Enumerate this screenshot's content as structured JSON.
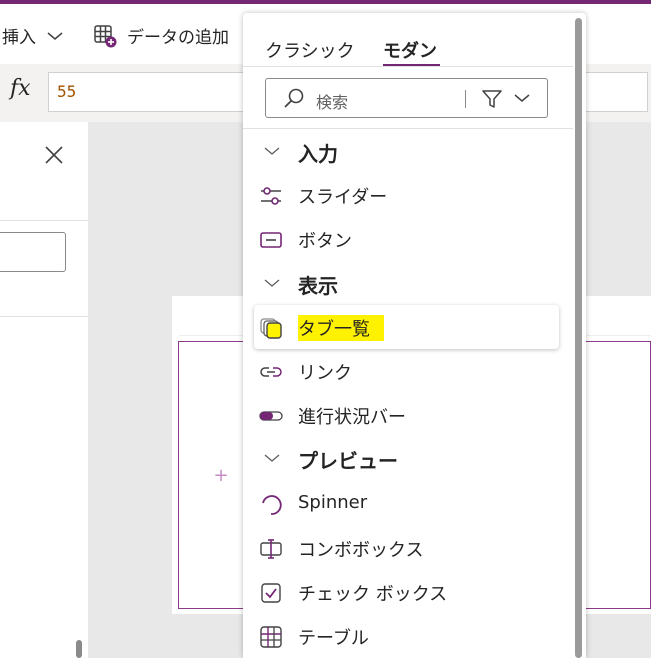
{
  "ribbon": {
    "insert_label": "挿入",
    "add_data_label": "データの追加"
  },
  "formula": {
    "fx_label": "fx",
    "value": "55"
  },
  "panel": {
    "tabs": [
      {
        "label": "クラシック",
        "active": false
      },
      {
        "label": "モダン",
        "active": true
      }
    ],
    "search_placeholder": "検索",
    "sections": [
      {
        "label": "入力",
        "items": [
          "スライダー",
          "ボタン"
        ]
      },
      {
        "label": "表示",
        "items": [
          "タブ一覧",
          "リンク",
          "進行状況バー"
        ]
      },
      {
        "label": "プレビュー",
        "items": [
          "Spinner",
          "コンボボックス",
          "チェック ボックス",
          "テーブル"
        ]
      }
    ]
  },
  "colors": {
    "accent": "#742774",
    "highlight": "#fff200",
    "formula_value": "#a35200"
  },
  "icons": {
    "insert_chevron": "chevron-down-icon",
    "add_data": "table-add-icon",
    "close": "close-icon",
    "search": "search-icon",
    "filter": "filter-icon"
  }
}
